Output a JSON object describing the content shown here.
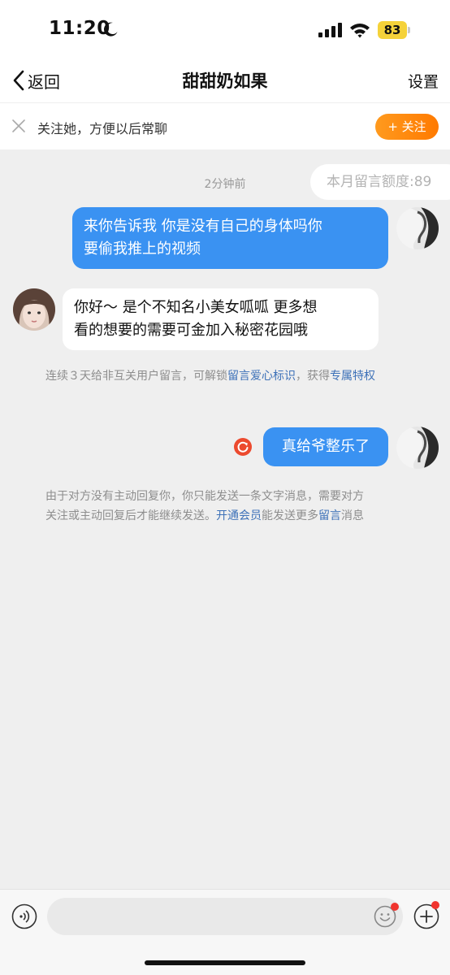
{
  "status_bar": {
    "time": "11:20",
    "battery": "83"
  },
  "nav": {
    "back_label": "返回",
    "title": "甜甜奶如果",
    "settings_label": "设置"
  },
  "follow_banner": {
    "text": "关注她，方便以后常聊",
    "button_label": "+ 关注"
  },
  "quota": "本月留言额度:89",
  "timestamp": "2分钟前",
  "messages": [
    {
      "direction": "out",
      "lines": [
        "来你告诉我 你是没有自己的身体吗你",
        "要偷我推上的视频"
      ]
    },
    {
      "direction": "in",
      "lines": [
        "你好～ 是个不知名小美女呱呱 更多想",
        "看的想要的需要可金加入秘密花园哦"
      ]
    },
    {
      "direction": "out",
      "lines": [
        "真给爷整乐了"
      ]
    }
  ],
  "notice1": {
    "prefix": "连续３天给非互关用户留言，可解锁",
    "link1": "留言爱心标识",
    "middle": "，获得",
    "link2": "专属特权"
  },
  "notice2": {
    "line1": "由于对方没有主动回复你，你只能发送一条文字消息，需要对方",
    "line2_prefix": "关注或主动回复后才能继续发送。",
    "link1": "开通会员",
    "middle": "能发送更多",
    "link2": "留言",
    "suffix": "消息"
  },
  "input": {
    "placeholder": ""
  },
  "colors": {
    "outgoing_bubble": "#3a92f2",
    "incoming_bubble": "#ffffff",
    "follow_button": "#ff8a00",
    "link": "#3d71b8",
    "battery": "#f5d23a"
  }
}
